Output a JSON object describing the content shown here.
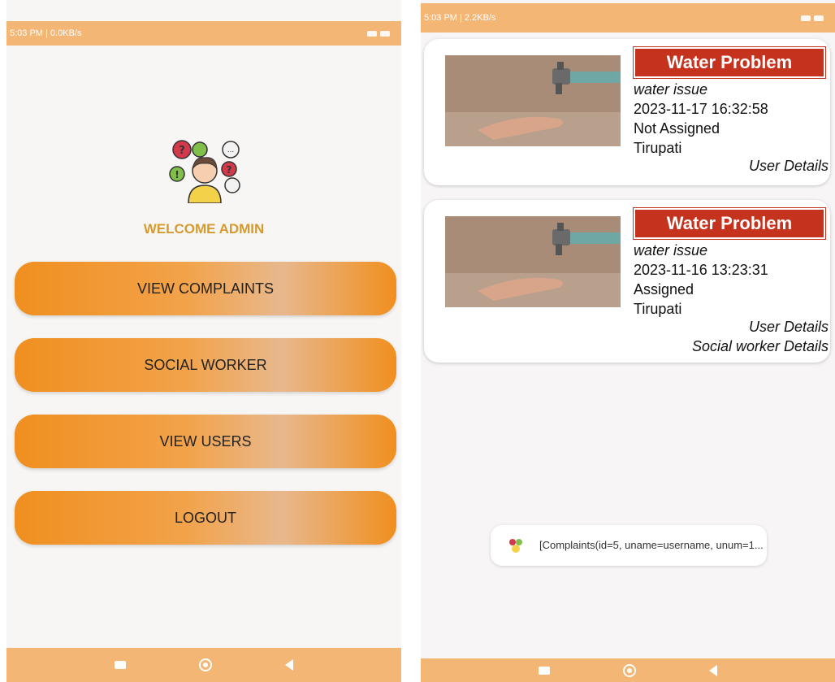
{
  "left": {
    "status_text": "5:03 PM | 0.0KB/s",
    "welcome": "WELCOME ADMIN",
    "menu": [
      "VIEW COMPLAINTS",
      "SOCIAL WORKER",
      "VIEW USERS",
      "LOGOUT"
    ],
    "logo_icon": "people-chat-icon"
  },
  "right": {
    "status_text": "5:03 PM | 2.2KB/s",
    "complaints": [
      {
        "title": "Water Problem",
        "description": "water issue",
        "datetime": "2023-11-17 16:32:58",
        "status": "Not Assigned",
        "location": "Tirupati",
        "user_details": "User Details"
      },
      {
        "title": "Water Problem",
        "description": "water issue",
        "datetime": "2023-11-16 13:23:31",
        "status": "Assigned",
        "location": "Tirupati",
        "user_details": "User Details",
        "worker_details": "Social worker Details"
      }
    ],
    "toast": "[Complaints(id=5, uname=username, unum=1..."
  },
  "colors": {
    "accent": "#f4b674",
    "button": "#f08f1f",
    "badge": "#c5321d",
    "welcome": "#d79a2d"
  }
}
